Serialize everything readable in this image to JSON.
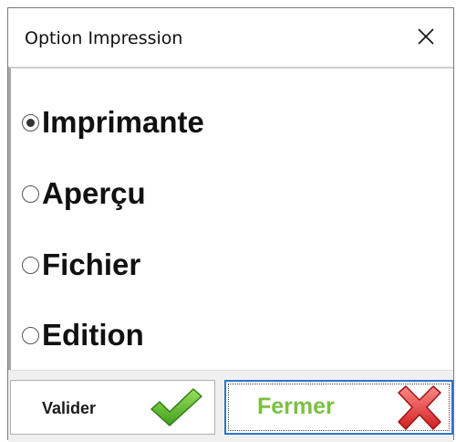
{
  "window": {
    "title": "Option Impression"
  },
  "options": [
    {
      "label": "Imprimante",
      "selected": true
    },
    {
      "label": "Aperçu",
      "selected": false
    },
    {
      "label": "Fichier",
      "selected": false
    },
    {
      "label": "Edition",
      "selected": false
    }
  ],
  "buttons": {
    "validate_label": "Valider",
    "close_label": "Fermer"
  },
  "icons": {
    "close": "close-icon",
    "validate": "green-check-icon",
    "cancel": "red-x-icon"
  },
  "colors": {
    "close_label": "#7bc043",
    "focus_border": "#2a74c9",
    "check_green": "#5cbf2a",
    "cross_red": "#e23b3b"
  }
}
